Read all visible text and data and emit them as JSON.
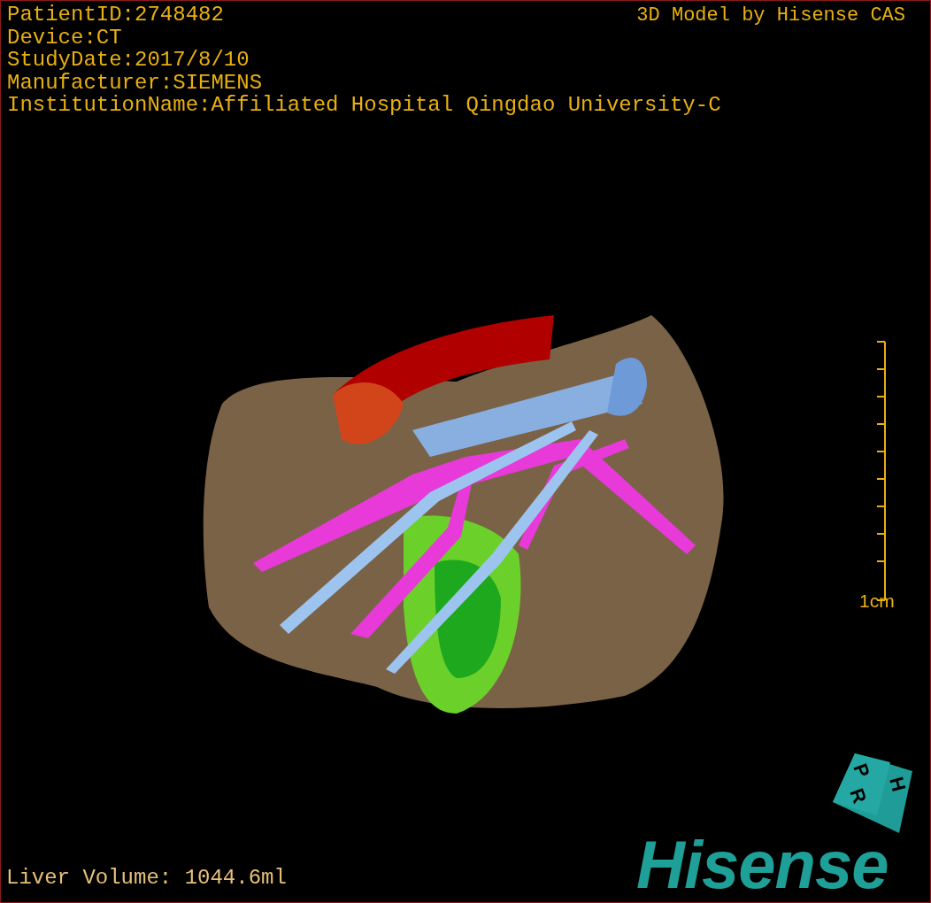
{
  "info_lines": [
    "PatientID:2748482",
    "Device:CT",
    "StudyDate:2017/8/10",
    "Manufacturer:SIEMENS",
    "InstitutionName:Affiliated Hospital Qingdao University-C"
  ],
  "viewer_title": "3D Model by Hisense CAS",
  "scale_bar": {
    "label": "1cm"
  },
  "orientation_cube": {
    "labels": [
      "P",
      "H",
      "R"
    ]
  },
  "logo": "Hisense",
  "measurement": "Liver Volume: 1044.6ml"
}
